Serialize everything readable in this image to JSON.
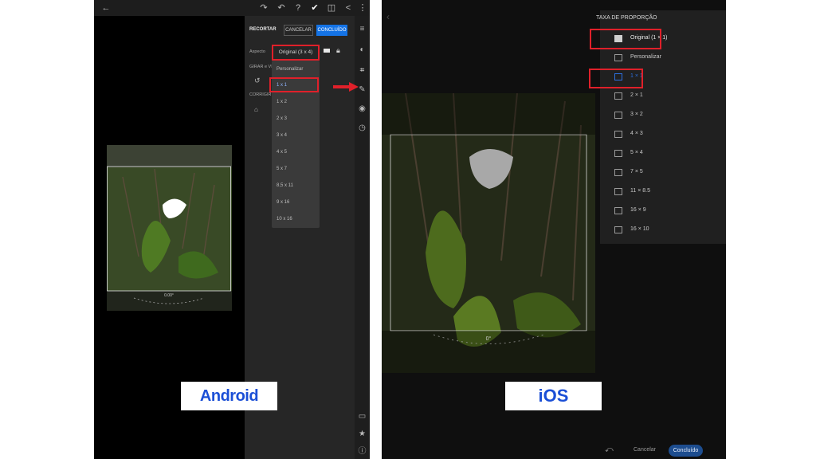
{
  "android": {
    "panel": {
      "title": "RECORTAR",
      "cancel_label": "CANCELAR",
      "done_label": "CONCLUÍDO",
      "aspect_label": "Aspecto",
      "aspect_value": "Original (3 x 4)",
      "rotate_label": "GIRAR e VIR",
      "correct_label": "CORRIGIR"
    },
    "dropdown_options": [
      "Personalizar",
      "1 x 1",
      "1 x 2",
      "2 x 3",
      "3 x 4",
      "4 x 5",
      "5 x 7",
      "8,5 x 11",
      "9 x 16",
      "10 x 16"
    ],
    "straighten_value": "0.00°",
    "platform_label": "Android"
  },
  "ios": {
    "menu_title": "TAXA DE PROPORÇÃO",
    "options": [
      "Original (1 × 1)",
      "Personalizar",
      "1 × 1",
      "2 × 1",
      "3 × 2",
      "4 × 3",
      "5 × 4",
      "7 × 5",
      "11 × 8.5",
      "16 × 9",
      "16 × 10"
    ],
    "straighten_value": "0°",
    "cancel_label": "Cancelar",
    "done_label": "Concluído",
    "platform_label": "iOS"
  },
  "colors": {
    "highlight": "#e0202a",
    "accent_blue": "#1473e6",
    "label_blue": "#1b4fd6"
  }
}
